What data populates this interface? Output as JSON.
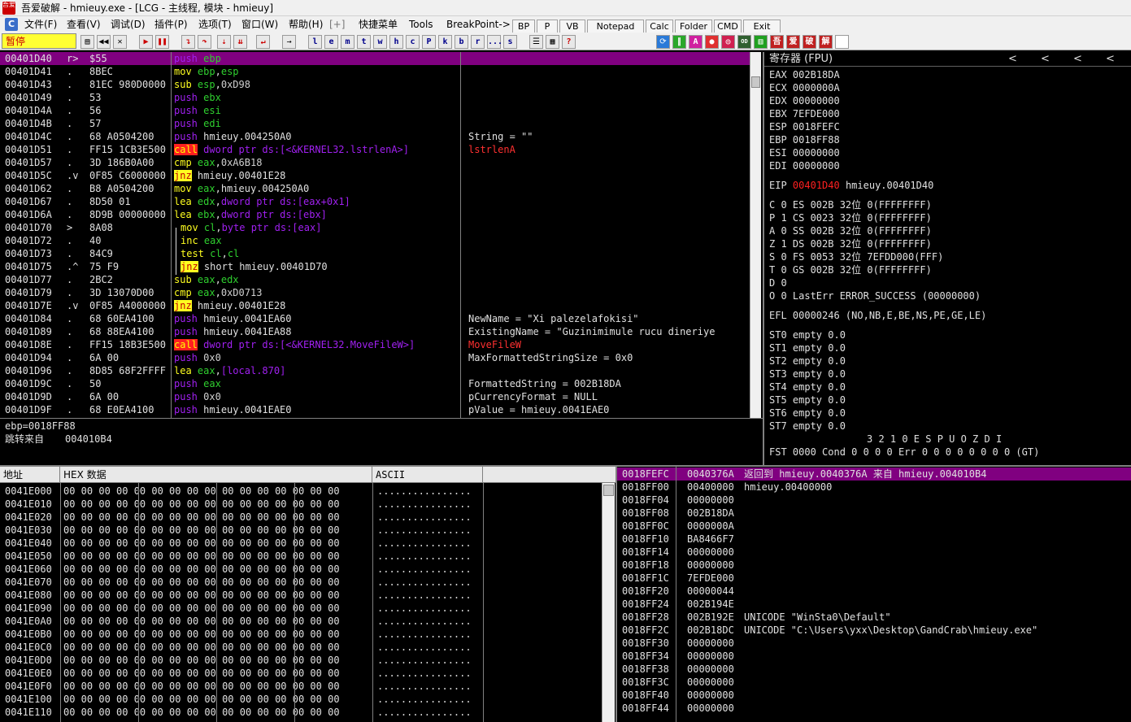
{
  "window": {
    "title": "吾爱破解 - hmieuy.exe - [LCG - 主线程, 模块 - hmieuy]",
    "app_icon_text": "吾爱"
  },
  "menu": {
    "items": [
      "文件(F)",
      "查看(V)",
      "调试(D)",
      "插件(P)",
      "选项(T)",
      "窗口(W)",
      "帮助(H)",
      "[+]",
      "快捷菜单",
      "Tools",
      "BreakPoint->"
    ],
    "quick_buttons": [
      "BP",
      "P",
      "VB",
      "Notepad",
      "Calc",
      "Folder",
      "CMD",
      "Exit"
    ]
  },
  "toolbar": {
    "status": "暂停",
    "letter_buttons": [
      "l",
      "e",
      "m",
      "t",
      "w",
      "h",
      "c",
      "P",
      "k",
      "b",
      "r",
      "...",
      "s"
    ]
  },
  "disasm": {
    "rows": [
      {
        "addr": "00401D40",
        "mark": "r>",
        "hex": "$55",
        "mn": "push",
        "args": [
          [
            "reg",
            "ebp"
          ]
        ],
        "comment": "",
        "sel": true
      },
      {
        "addr": "00401D41",
        "mark": ".",
        "hex": "8BEC",
        "mn": "mov",
        "args": [
          [
            "reg",
            "ebp"
          ],
          [
            "plain",
            ","
          ],
          [
            "reg",
            "esp"
          ]
        ],
        "comment": ""
      },
      {
        "addr": "00401D43",
        "mark": ".",
        "hex": "81EC 980D0000",
        "mn": "sub",
        "args": [
          [
            "reg",
            "esp"
          ],
          [
            "plain",
            ","
          ],
          [
            "imm",
            "0xD98"
          ]
        ],
        "comment": ""
      },
      {
        "addr": "00401D49",
        "mark": ".",
        "hex": "53",
        "mn": "push",
        "args": [
          [
            "reg",
            "ebx"
          ]
        ],
        "comment": ""
      },
      {
        "addr": "00401D4A",
        "mark": ".",
        "hex": "56",
        "mn": "push",
        "args": [
          [
            "reg",
            "esi"
          ]
        ],
        "comment": ""
      },
      {
        "addr": "00401D4B",
        "mark": ".",
        "hex": "57",
        "mn": "push",
        "args": [
          [
            "reg",
            "edi"
          ]
        ],
        "comment": ""
      },
      {
        "addr": "00401D4C",
        "mark": ".",
        "hex": "68 A0504200",
        "mn": "push",
        "args": [
          [
            "plain",
            "hmieuy.004250A0"
          ]
        ],
        "comment": "String = \"\""
      },
      {
        "addr": "00401D51",
        "mark": ".",
        "hex": "FF15 1CB3E500",
        "mn": "call",
        "args": [
          [
            "mem",
            "dword ptr ds:[<&KERNEL32.lstrlenA>]"
          ]
        ],
        "comment": "lstrlenA",
        "comment_red": true
      },
      {
        "addr": "00401D57",
        "mark": ".",
        "hex": "3D 186B0A00",
        "mn": "cmp",
        "args": [
          [
            "reg",
            "eax"
          ],
          [
            "plain",
            ","
          ],
          [
            "imm",
            "0xA6B18"
          ]
        ],
        "comment": ""
      },
      {
        "addr": "00401D5C",
        "mark": ".v",
        "hex": "0F85 C6000000",
        "mn": "jnz",
        "args": [
          [
            "plain",
            "hmieuy.00401E28"
          ]
        ],
        "comment": ""
      },
      {
        "addr": "00401D62",
        "mark": ".",
        "hex": "B8 A0504200",
        "mn": "mov",
        "args": [
          [
            "reg",
            "eax"
          ],
          [
            "plain",
            ",hmieuy.004250A0"
          ]
        ],
        "comment": ""
      },
      {
        "addr": "00401D67",
        "mark": ".",
        "hex": "8D50 01",
        "mn": "lea",
        "args": [
          [
            "reg",
            "edx"
          ],
          [
            "plain",
            ","
          ],
          [
            "mem",
            "dword ptr ds:[eax+0x1]"
          ]
        ],
        "comment": ""
      },
      {
        "addr": "00401D6A",
        "mark": ".",
        "hex": "8D9B 00000000",
        "mn": "lea",
        "args": [
          [
            "reg",
            "ebx"
          ],
          [
            "plain",
            ","
          ],
          [
            "mem",
            "dword ptr ds:[ebx]"
          ]
        ],
        "comment": ""
      },
      {
        "addr": "00401D70",
        "mark": ">",
        "hex": "8A08",
        "mn": "mov",
        "args": [
          [
            "reg",
            "cl"
          ],
          [
            "plain",
            ","
          ],
          [
            "mem",
            "byte ptr ds:[eax]"
          ]
        ],
        "comment": "",
        "indent": true
      },
      {
        "addr": "00401D72",
        "mark": ".",
        "hex": "40",
        "mn": "inc",
        "args": [
          [
            "reg",
            "eax"
          ]
        ],
        "comment": "",
        "indent": true
      },
      {
        "addr": "00401D73",
        "mark": ".",
        "hex": "84C9",
        "mn": "test",
        "args": [
          [
            "reg",
            "cl"
          ],
          [
            "plain",
            ","
          ],
          [
            "reg",
            "cl"
          ]
        ],
        "comment": "",
        "indent": true
      },
      {
        "addr": "00401D75",
        "mark": ".^",
        "hex": "75 F9",
        "mn": "jnz",
        "args": [
          [
            "plain",
            "short hmieuy.00401D70"
          ]
        ],
        "comment": "",
        "indent": true
      },
      {
        "addr": "00401D77",
        "mark": ".",
        "hex": "2BC2",
        "mn": "sub",
        "args": [
          [
            "reg",
            "eax"
          ],
          [
            "plain",
            ","
          ],
          [
            "reg",
            "edx"
          ]
        ],
        "comment": ""
      },
      {
        "addr": "00401D79",
        "mark": ".",
        "hex": "3D 13070D00",
        "mn": "cmp",
        "args": [
          [
            "reg",
            "eax"
          ],
          [
            "plain",
            ","
          ],
          [
            "imm",
            "0xD0713"
          ]
        ],
        "comment": ""
      },
      {
        "addr": "00401D7E",
        "mark": ".v",
        "hex": "0F85 A4000000",
        "mn": "jnz",
        "args": [
          [
            "plain",
            "hmieuy.00401E28"
          ]
        ],
        "comment": ""
      },
      {
        "addr": "00401D84",
        "mark": ".",
        "hex": "68 60EA4100",
        "mn": "push",
        "args": [
          [
            "plain",
            "hmieuy.0041EA60"
          ]
        ],
        "comment": "NewName = \"Xi palezelafokisi\""
      },
      {
        "addr": "00401D89",
        "mark": ".",
        "hex": "68 88EA4100",
        "mn": "push",
        "args": [
          [
            "plain",
            "hmieuy.0041EA88"
          ]
        ],
        "comment": "ExistingName = \"Guzinimimule rucu dineriye"
      },
      {
        "addr": "00401D8E",
        "mark": ".",
        "hex": "FF15 18B3E500",
        "mn": "call",
        "args": [
          [
            "mem",
            "dword ptr ds:[<&KERNEL32.MoveFileW>]"
          ]
        ],
        "comment": "MoveFileW",
        "comment_red": true
      },
      {
        "addr": "00401D94",
        "mark": ".",
        "hex": "6A 00",
        "mn": "push",
        "args": [
          [
            "imm",
            "0x0"
          ]
        ],
        "comment": "MaxFormattedStringSize = 0x0"
      },
      {
        "addr": "00401D96",
        "mark": ".",
        "hex": "8D85 68F2FFFF",
        "mn": "lea",
        "args": [
          [
            "reg",
            "eax"
          ],
          [
            "plain",
            ","
          ],
          [
            "mem",
            "[local.870]"
          ]
        ],
        "comment": ""
      },
      {
        "addr": "00401D9C",
        "mark": ".",
        "hex": "50",
        "mn": "push",
        "args": [
          [
            "reg",
            "eax"
          ]
        ],
        "comment": "FormattedString = 002B18DA"
      },
      {
        "addr": "00401D9D",
        "mark": ".",
        "hex": "6A 00",
        "mn": "push",
        "args": [
          [
            "imm",
            "0x0"
          ]
        ],
        "comment": "pCurrencyFormat = NULL"
      },
      {
        "addr": "00401D9F",
        "mark": ".",
        "hex": "68 E0EA4100",
        "mn": "push",
        "args": [
          [
            "plain",
            "hmieuy.0041EAE0"
          ]
        ],
        "comment": "pValue = hmieuy.0041EAE0"
      }
    ]
  },
  "info": {
    "line1": "ebp=0018FF88",
    "line2_label": "跳转来自",
    "line2_value": "004010B4"
  },
  "registers": {
    "title": "寄存器 (FPU)",
    "arrows": [
      "<",
      "<",
      "<",
      "<"
    ],
    "gp": [
      {
        "name": "EAX",
        "value": "002B18DA"
      },
      {
        "name": "ECX",
        "value": "0000000A"
      },
      {
        "name": "EDX",
        "value": "00000000"
      },
      {
        "name": "EBX",
        "value": "7EFDE000"
      },
      {
        "name": "ESP",
        "value": "0018FEFC"
      },
      {
        "name": "EBP",
        "value": "0018FF88"
      },
      {
        "name": "ESI",
        "value": "00000000"
      },
      {
        "name": "EDI",
        "value": "00000000"
      }
    ],
    "eip": {
      "name": "EIP",
      "value": "00401D40",
      "sym": "hmieuy.00401D40"
    },
    "flags": [
      "C 0  ES 002B 32位 0(FFFFFFFF)",
      "P 1  CS 0023 32位 0(FFFFFFFF)",
      "A 0  SS 002B 32位 0(FFFFFFFF)",
      "Z 1  DS 002B 32位 0(FFFFFFFF)",
      "S 0  FS 0053 32位 7EFDD000(FFF)",
      "T 0  GS 002B 32位 0(FFFFFFFF)",
      "D 0",
      "O 0  LastErr ERROR_SUCCESS (00000000)"
    ],
    "efl": "EFL 00000246 (NO,NB,E,BE,NS,PE,GE,LE)",
    "fpu": [
      "ST0 empty 0.0",
      "ST1 empty 0.0",
      "ST2 empty 0.0",
      "ST3 empty 0.0",
      "ST4 empty 0.0",
      "ST5 empty 0.0",
      "ST6 empty 0.0",
      "ST7 empty 0.0"
    ],
    "fpu_header": "3 2 1 0      E S P U O Z D I",
    "fst": "FST 0000  Cond 0 0 0 0  Err 0 0 0 0 0 0 0 0  (GT)"
  },
  "dump": {
    "headers": [
      "地址",
      "HEX 数据",
      "ASCII"
    ],
    "hex_line": "00 00 00 00 00 00 00 00 00 00 00 00 00 00 00 00",
    "ascii_line": "................",
    "rows": [
      "0041E000",
      "0041E010",
      "0041E020",
      "0041E030",
      "0041E040",
      "0041E050",
      "0041E060",
      "0041E070",
      "0041E080",
      "0041E090",
      "0041E0A0",
      "0041E0B0",
      "0041E0C0",
      "0041E0D0",
      "0041E0E0",
      "0041E0F0",
      "0041E100",
      "0041E110"
    ]
  },
  "stack": {
    "rows": [
      {
        "addr": "0018FEFC",
        "val": "0040376A",
        "comment": "返回到 hmieuy.0040376A 来自 hmieuy.004010B4",
        "sel": true
      },
      {
        "addr": "0018FF00",
        "val": "00400000",
        "comment": "hmieuy.00400000"
      },
      {
        "addr": "0018FF04",
        "val": "00000000",
        "comment": ""
      },
      {
        "addr": "0018FF08",
        "val": "002B18DA",
        "comment": ""
      },
      {
        "addr": "0018FF0C",
        "val": "0000000A",
        "comment": ""
      },
      {
        "addr": "0018FF10",
        "val": "BA8466F7",
        "comment": ""
      },
      {
        "addr": "0018FF14",
        "val": "00000000",
        "comment": ""
      },
      {
        "addr": "0018FF18",
        "val": "00000000",
        "comment": ""
      },
      {
        "addr": "0018FF1C",
        "val": "7EFDE000",
        "comment": ""
      },
      {
        "addr": "0018FF20",
        "val": "00000044",
        "comment": ""
      },
      {
        "addr": "0018FF24",
        "val": "002B194E",
        "comment": ""
      },
      {
        "addr": "0018FF28",
        "val": "002B192E",
        "comment": "UNICODE \"WinSta0\\Default\""
      },
      {
        "addr": "0018FF2C",
        "val": "002B18DC",
        "comment": "UNICODE \"C:\\Users\\yxx\\Desktop\\GandCrab\\hmieuy.exe\""
      },
      {
        "addr": "0018FF30",
        "val": "00000000",
        "comment": ""
      },
      {
        "addr": "0018FF34",
        "val": "00000000",
        "comment": ""
      },
      {
        "addr": "0018FF38",
        "val": "00000000",
        "comment": ""
      },
      {
        "addr": "0018FF3C",
        "val": "00000000",
        "comment": ""
      },
      {
        "addr": "0018FF40",
        "val": "00000000",
        "comment": ""
      },
      {
        "addr": "0018FF44",
        "val": "00000000",
        "comment": ""
      }
    ]
  }
}
